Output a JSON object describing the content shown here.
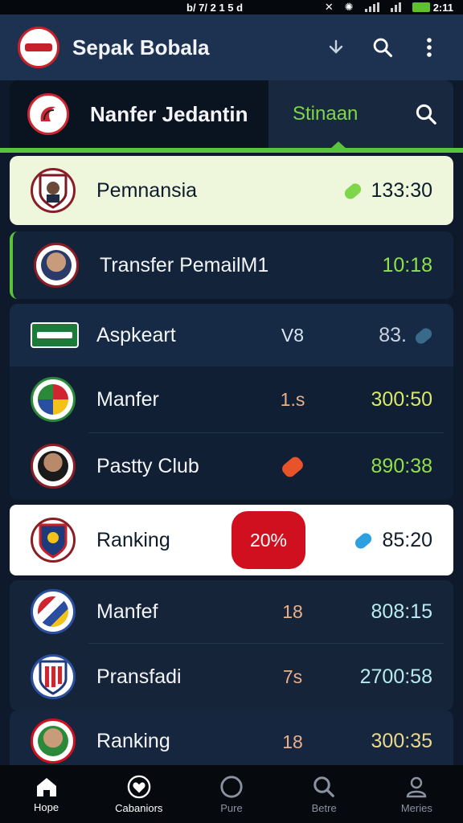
{
  "status": {
    "left": "b/ 7/ 2 1 5 d",
    "time": "2:11"
  },
  "app": {
    "title": "Sepak Bobala"
  },
  "header_icons": [
    "download-icon",
    "search-icon",
    "more-icon"
  ],
  "subheader": {
    "title": "Nanfer Jedantin",
    "tab_label": "Stinaan"
  },
  "rows": [
    {
      "name": "Pemnansia",
      "mid": "",
      "time": "133:30"
    },
    {
      "name": "Transfer PemailM1",
      "mid": "",
      "time": "10:18"
    },
    {
      "name": "Aspkeart",
      "mid": "V8",
      "time": "83."
    },
    {
      "name": "Manfer",
      "mid": "1.s",
      "time": "300:50"
    },
    {
      "name": "Pastty Club",
      "mid": "",
      "time": "890:38"
    },
    {
      "name": "Ranking",
      "mid": "20%",
      "time": "85:20"
    },
    {
      "name": "Manfef",
      "mid": "18",
      "time": "808:15"
    },
    {
      "name": "Pransfadi",
      "mid": "7s",
      "time": "2700:58"
    },
    {
      "name": "Ranking",
      "mid": "18",
      "time": "300:35"
    }
  ],
  "nav": [
    {
      "label": "Hope",
      "icon": "home-icon"
    },
    {
      "label": "Cabaniors",
      "icon": "heart-icon"
    },
    {
      "label": "Pure",
      "icon": "circle-icon"
    },
    {
      "label": "Betre",
      "icon": "search-icon"
    },
    {
      "label": "Meries",
      "icon": "profile-icon"
    }
  ],
  "colors": {
    "accent": "#5cc23a",
    "time_green": "#8fe04a",
    "time_yellow": "#d7e86a",
    "time_cyan": "#b8eaf0",
    "time_gold": "#e8d890",
    "pill": "#d0101e",
    "header": "#1c3250"
  }
}
